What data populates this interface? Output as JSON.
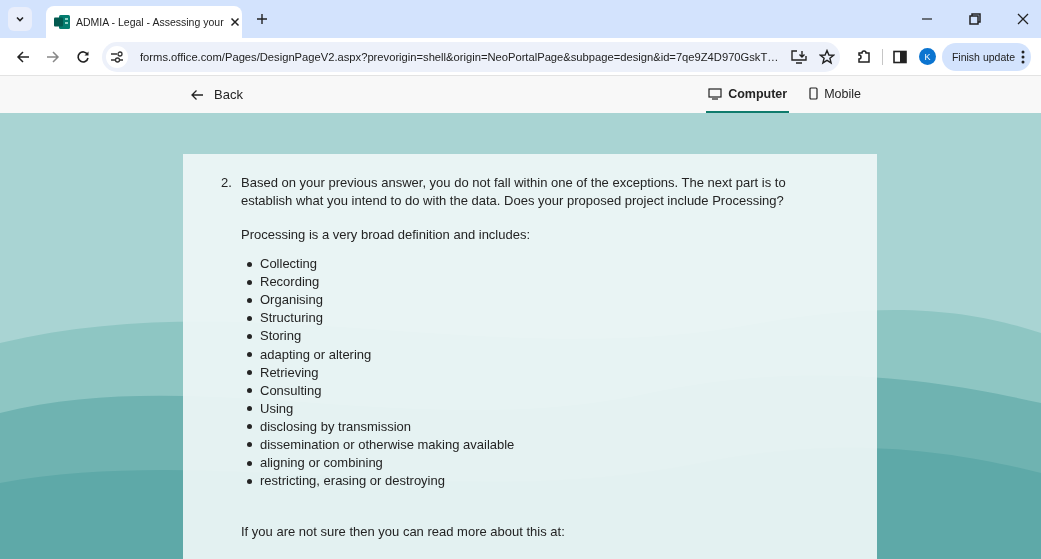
{
  "browser": {
    "tab": {
      "title": "ADMIA - Legal - Assessing your",
      "selected": true
    },
    "address": "forms.office.com/Pages/DesignPageV2.aspx?prevorigin=shell&origin=NeoPortalPage&subpage=design&id=7qe9Z4D970GskT…",
    "profile_initial": "K",
    "update_button": "Finish update"
  },
  "header": {
    "back": "Back",
    "views": [
      {
        "label": "Computer",
        "selected": true,
        "kind": "computer"
      },
      {
        "label": "Mobile",
        "selected": false,
        "kind": "mobile"
      }
    ]
  },
  "question": {
    "number": "2.",
    "text": "Based on your previous answer, you do not fall within one of the exceptions. The next part is to establish what you intend to do with the data. Does your proposed project include Processing?",
    "intro": "Processing is a very broad definition and includes:",
    "items": [
      "Collecting",
      "Recording",
      "Organising",
      "Structuring",
      "Storing",
      "adapting or altering",
      "Retrieving",
      "Consulting",
      "Using",
      "disclosing by transmission",
      "dissemination or otherwise making available",
      "aligning or combining",
      "restricting, erasing or destroying"
    ],
    "footer": "If you are not sure then you can read more about this at:"
  }
}
